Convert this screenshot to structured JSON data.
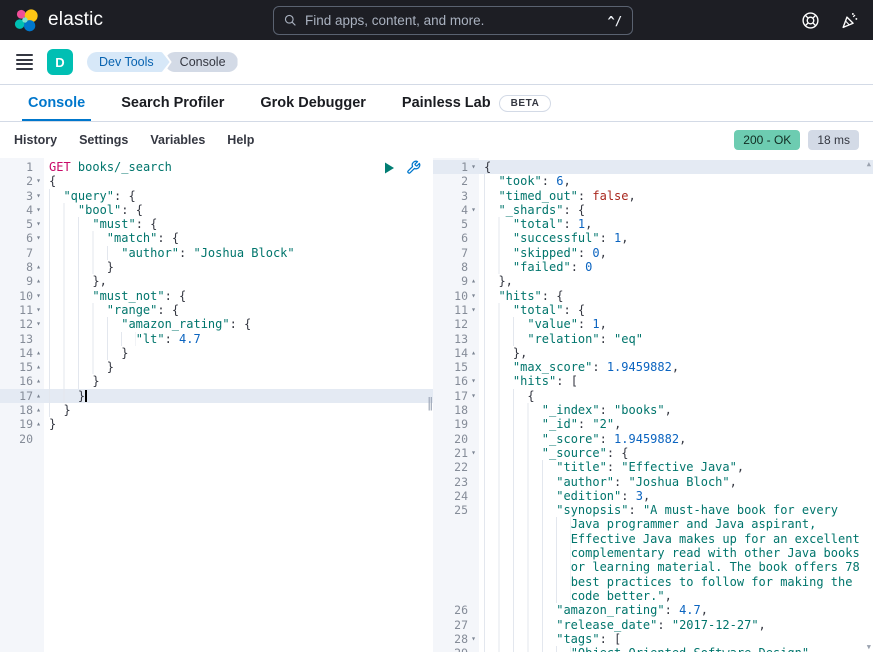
{
  "topbar": {
    "brand": "elastic",
    "search": {
      "placeholder": "Find apps, content, and more.",
      "shortcut": "^/"
    },
    "icons": {
      "search": "magnifier-icon",
      "help": "life-ring-help-icon",
      "news": "party-popper-news-icon"
    }
  },
  "nav": {
    "space_badge": "D",
    "breadcrumbs": [
      "Dev Tools",
      "Console"
    ]
  },
  "tabs": [
    {
      "label": "Console",
      "active": true
    },
    {
      "label": "Search Profiler"
    },
    {
      "label": "Grok Debugger"
    },
    {
      "label": "Painless Lab",
      "badge": "BETA"
    }
  ],
  "toolbar": {
    "items": [
      "History",
      "Settings",
      "Variables",
      "Help"
    ],
    "status_badge": "200 - OK",
    "time_badge": "18 ms"
  },
  "request_editor": {
    "lines": [
      {
        "num": "1",
        "fold": "",
        "indent": 0,
        "segments": [
          [
            "m",
            "GET"
          ],
          [
            "p",
            " "
          ],
          [
            "u",
            "books/_search"
          ]
        ]
      },
      {
        "num": "2",
        "fold": "open",
        "indent": 0,
        "segments": [
          [
            "p",
            "{"
          ]
        ]
      },
      {
        "num": "3",
        "fold": "open",
        "indent": 2,
        "segments": [
          [
            "s",
            "\"query\""
          ],
          [
            "p",
            ": {"
          ]
        ]
      },
      {
        "num": "4",
        "fold": "open",
        "indent": 4,
        "segments": [
          [
            "s",
            "\"bool\""
          ],
          [
            "p",
            ": {"
          ]
        ]
      },
      {
        "num": "5",
        "fold": "open",
        "indent": 6,
        "segments": [
          [
            "s",
            "\"must\""
          ],
          [
            "p",
            ": {"
          ]
        ]
      },
      {
        "num": "6",
        "fold": "open",
        "indent": 8,
        "segments": [
          [
            "s",
            "\"match\""
          ],
          [
            "p",
            ": {"
          ]
        ]
      },
      {
        "num": "7",
        "fold": "",
        "indent": 10,
        "segments": [
          [
            "s",
            "\"author\""
          ],
          [
            "p",
            ": "
          ],
          [
            "s",
            "\"Joshua Block\""
          ]
        ]
      },
      {
        "num": "8",
        "fold": "close",
        "indent": 8,
        "segments": [
          [
            "p",
            "}"
          ]
        ]
      },
      {
        "num": "9",
        "fold": "close",
        "indent": 6,
        "segments": [
          [
            "p",
            "},"
          ]
        ]
      },
      {
        "num": "10",
        "fold": "open",
        "indent": 6,
        "segments": [
          [
            "s",
            "\"must_not\""
          ],
          [
            "p",
            ": {"
          ]
        ]
      },
      {
        "num": "11",
        "fold": "open",
        "indent": 8,
        "segments": [
          [
            "s",
            "\"range\""
          ],
          [
            "p",
            ": {"
          ]
        ]
      },
      {
        "num": "12",
        "fold": "open",
        "indent": 10,
        "segments": [
          [
            "s",
            "\"amazon_rating\""
          ],
          [
            "p",
            ": {"
          ]
        ]
      },
      {
        "num": "13",
        "fold": "",
        "indent": 12,
        "segments": [
          [
            "s",
            "\"lt\""
          ],
          [
            "p",
            ": "
          ],
          [
            "n",
            "4.7"
          ]
        ]
      },
      {
        "num": "14",
        "fold": "close",
        "indent": 10,
        "segments": [
          [
            "p",
            "}"
          ]
        ]
      },
      {
        "num": "15",
        "fold": "close",
        "indent": 8,
        "segments": [
          [
            "p",
            "}"
          ]
        ]
      },
      {
        "num": "16",
        "fold": "close",
        "indent": 6,
        "segments": [
          [
            "p",
            "}"
          ]
        ]
      },
      {
        "num": "17",
        "fold": "close",
        "indent": 4,
        "active": true,
        "segments": [
          [
            "p",
            "}"
          ],
          [
            "cur",
            ""
          ]
        ]
      },
      {
        "num": "18",
        "fold": "close",
        "indent": 2,
        "segments": [
          [
            "p",
            "}"
          ]
        ]
      },
      {
        "num": "19",
        "fold": "close",
        "indent": 0,
        "segments": [
          [
            "p",
            "}"
          ]
        ]
      },
      {
        "num": "20",
        "fold": "",
        "indent": 0,
        "segments": []
      }
    ]
  },
  "response_editor": {
    "lines": [
      {
        "num": "1",
        "fold": "open",
        "indent": 0,
        "active": true,
        "segments": [
          [
            "p",
            "{"
          ]
        ]
      },
      {
        "num": "2",
        "fold": "",
        "indent": 2,
        "segments": [
          [
            "s",
            "\"took\""
          ],
          [
            "p",
            ": "
          ],
          [
            "n",
            "6"
          ],
          [
            "p",
            ","
          ]
        ]
      },
      {
        "num": "3",
        "fold": "",
        "indent": 2,
        "segments": [
          [
            "s",
            "\"timed_out\""
          ],
          [
            "p",
            ": "
          ],
          [
            "b",
            "false"
          ],
          [
            "p",
            ","
          ]
        ]
      },
      {
        "num": "4",
        "fold": "open",
        "indent": 2,
        "segments": [
          [
            "s",
            "\"_shards\""
          ],
          [
            "p",
            ": {"
          ]
        ]
      },
      {
        "num": "5",
        "fold": "",
        "indent": 4,
        "segments": [
          [
            "s",
            "\"total\""
          ],
          [
            "p",
            ": "
          ],
          [
            "n",
            "1"
          ],
          [
            "p",
            ","
          ]
        ]
      },
      {
        "num": "6",
        "fold": "",
        "indent": 4,
        "segments": [
          [
            "s",
            "\"successful\""
          ],
          [
            "p",
            ": "
          ],
          [
            "n",
            "1"
          ],
          [
            "p",
            ","
          ]
        ]
      },
      {
        "num": "7",
        "fold": "",
        "indent": 4,
        "segments": [
          [
            "s",
            "\"skipped\""
          ],
          [
            "p",
            ": "
          ],
          [
            "n",
            "0"
          ],
          [
            "p",
            ","
          ]
        ]
      },
      {
        "num": "8",
        "fold": "",
        "indent": 4,
        "segments": [
          [
            "s",
            "\"failed\""
          ],
          [
            "p",
            ": "
          ],
          [
            "n",
            "0"
          ]
        ]
      },
      {
        "num": "9",
        "fold": "close",
        "indent": 2,
        "segments": [
          [
            "p",
            "},"
          ]
        ]
      },
      {
        "num": "10",
        "fold": "open",
        "indent": 2,
        "segments": [
          [
            "s",
            "\"hits\""
          ],
          [
            "p",
            ": {"
          ]
        ]
      },
      {
        "num": "11",
        "fold": "open",
        "indent": 4,
        "segments": [
          [
            "s",
            "\"total\""
          ],
          [
            "p",
            ": {"
          ]
        ]
      },
      {
        "num": "12",
        "fold": "",
        "indent": 6,
        "segments": [
          [
            "s",
            "\"value\""
          ],
          [
            "p",
            ": "
          ],
          [
            "n",
            "1"
          ],
          [
            "p",
            ","
          ]
        ]
      },
      {
        "num": "13",
        "fold": "",
        "indent": 6,
        "segments": [
          [
            "s",
            "\"relation\""
          ],
          [
            "p",
            ": "
          ],
          [
            "s",
            "\"eq\""
          ]
        ]
      },
      {
        "num": "14",
        "fold": "close",
        "indent": 4,
        "segments": [
          [
            "p",
            "},"
          ]
        ]
      },
      {
        "num": "15",
        "fold": "",
        "indent": 4,
        "segments": [
          [
            "s",
            "\"max_score\""
          ],
          [
            "p",
            ": "
          ],
          [
            "n",
            "1.9459882"
          ],
          [
            "p",
            ","
          ]
        ]
      },
      {
        "num": "16",
        "fold": "open",
        "indent": 4,
        "segments": [
          [
            "s",
            "\"hits\""
          ],
          [
            "p",
            ": ["
          ]
        ]
      },
      {
        "num": "17",
        "fold": "open",
        "indent": 6,
        "segments": [
          [
            "p",
            "{"
          ]
        ]
      },
      {
        "num": "18",
        "fold": "",
        "indent": 8,
        "segments": [
          [
            "s",
            "\"_index\""
          ],
          [
            "p",
            ": "
          ],
          [
            "s",
            "\"books\""
          ],
          [
            "p",
            ","
          ]
        ]
      },
      {
        "num": "19",
        "fold": "",
        "indent": 8,
        "segments": [
          [
            "s",
            "\"_id\""
          ],
          [
            "p",
            ": "
          ],
          [
            "s",
            "\"2\""
          ],
          [
            "p",
            ","
          ]
        ]
      },
      {
        "num": "20",
        "fold": "",
        "indent": 8,
        "segments": [
          [
            "s",
            "\"_score\""
          ],
          [
            "p",
            ": "
          ],
          [
            "n",
            "1.9459882"
          ],
          [
            "p",
            ","
          ]
        ]
      },
      {
        "num": "21",
        "fold": "open",
        "indent": 8,
        "segments": [
          [
            "s",
            "\"_source\""
          ],
          [
            "p",
            ": {"
          ]
        ]
      },
      {
        "num": "22",
        "fold": "",
        "indent": 10,
        "segments": [
          [
            "s",
            "\"title\""
          ],
          [
            "p",
            ": "
          ],
          [
            "s",
            "\"Effective Java\""
          ],
          [
            "p",
            ","
          ]
        ]
      },
      {
        "num": "23",
        "fold": "",
        "indent": 10,
        "segments": [
          [
            "s",
            "\"author\""
          ],
          [
            "p",
            ": "
          ],
          [
            "s",
            "\"Joshua Bloch\""
          ],
          [
            "p",
            ","
          ]
        ]
      },
      {
        "num": "24",
        "fold": "",
        "indent": 10,
        "segments": [
          [
            "s",
            "\"edition\""
          ],
          [
            "p",
            ": "
          ],
          [
            "n",
            "3"
          ],
          [
            "p",
            ","
          ]
        ]
      },
      {
        "num": "25",
        "fold": "",
        "indent": 10,
        "segments": [
          [
            "s",
            "\"synopsis\""
          ],
          [
            "p",
            ": "
          ],
          [
            "s",
            "\"A must-have book for every"
          ]
        ]
      },
      {
        "num": "",
        "fold": "",
        "indent": 12,
        "segments": [
          [
            "s",
            "Java programmer and Java aspirant,"
          ]
        ]
      },
      {
        "num": "",
        "fold": "",
        "indent": 12,
        "segments": [
          [
            "s",
            "Effective Java makes up for an excellent"
          ]
        ]
      },
      {
        "num": "",
        "fold": "",
        "indent": 12,
        "segments": [
          [
            "s",
            "complementary read with other Java books"
          ]
        ]
      },
      {
        "num": "",
        "fold": "",
        "indent": 12,
        "segments": [
          [
            "s",
            "or learning material. The book offers 78"
          ]
        ]
      },
      {
        "num": "",
        "fold": "",
        "indent": 12,
        "segments": [
          [
            "s",
            "best practices to follow for making the"
          ]
        ]
      },
      {
        "num": "",
        "fold": "",
        "indent": 12,
        "segments": [
          [
            "s",
            "code better.\""
          ],
          [
            "p",
            ","
          ]
        ]
      },
      {
        "num": "26",
        "fold": "",
        "indent": 10,
        "segments": [
          [
            "s",
            "\"amazon_rating\""
          ],
          [
            "p",
            ": "
          ],
          [
            "n",
            "4.7"
          ],
          [
            "p",
            ","
          ]
        ]
      },
      {
        "num": "27",
        "fold": "",
        "indent": 10,
        "segments": [
          [
            "s",
            "\"release_date\""
          ],
          [
            "p",
            ": "
          ],
          [
            "s",
            "\"2017-12-27\""
          ],
          [
            "p",
            ","
          ]
        ]
      },
      {
        "num": "28",
        "fold": "open",
        "indent": 10,
        "segments": [
          [
            "s",
            "\"tags\""
          ],
          [
            "p",
            ": ["
          ]
        ]
      },
      {
        "num": "29",
        "fold": "",
        "indent": 12,
        "segments": [
          [
            "s",
            "\"Object Oriented Software Design\""
          ],
          [
            "p",
            ","
          ]
        ]
      }
    ]
  },
  "colors": {
    "accent_blue": "#0077cc",
    "teal_badge": "#00bfb3",
    "success_badge": "#6dccb1",
    "method_pink": "#c80a68",
    "string_green": "#00756c",
    "number_blue": "#0b64c0",
    "boolean_red": "#a8261d"
  }
}
